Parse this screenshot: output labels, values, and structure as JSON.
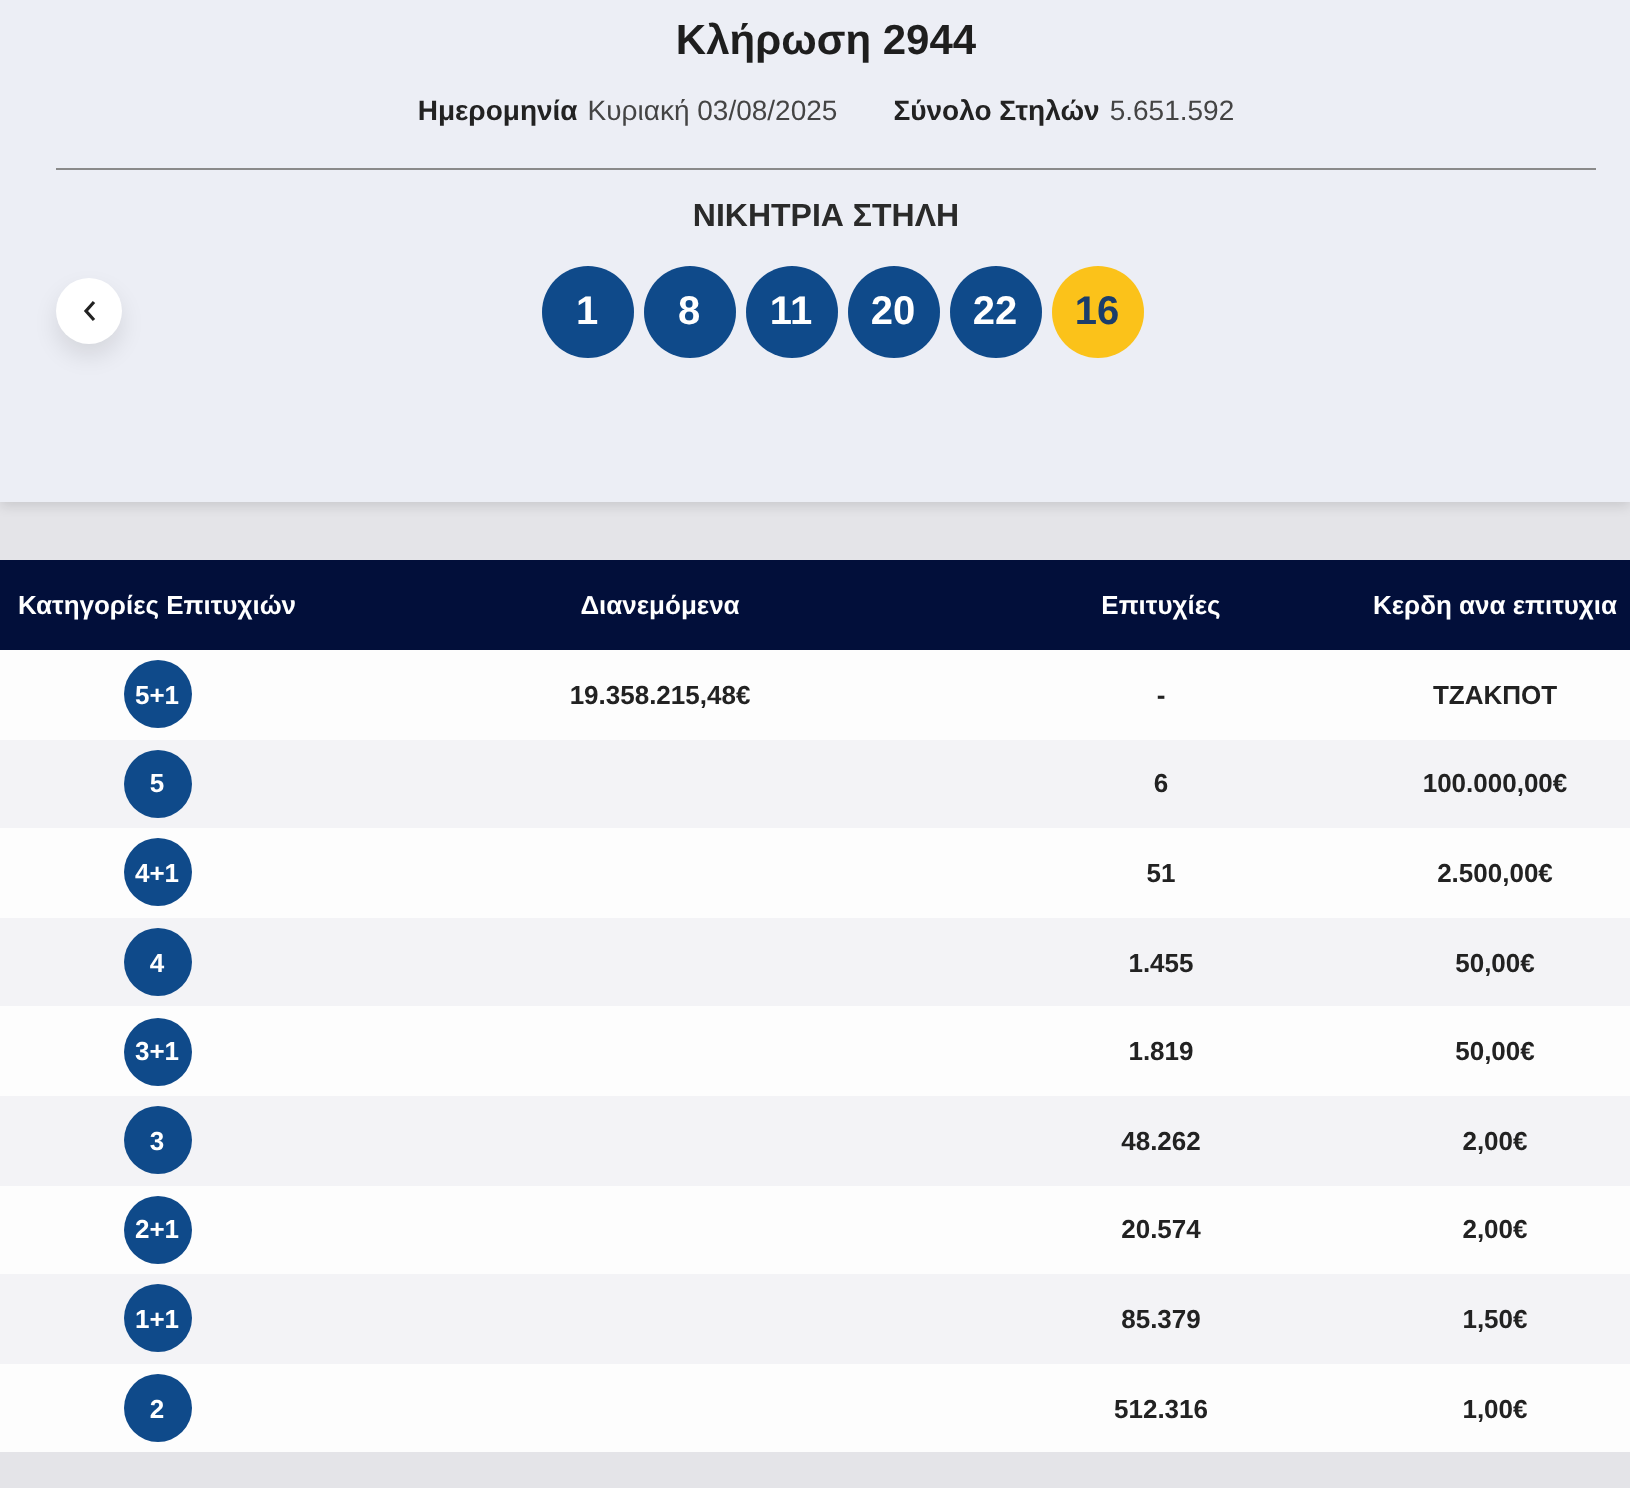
{
  "draw": {
    "title": "Κλήρωση 2944",
    "meta": [
      {
        "label": "Ημερομηνία",
        "value": "Κυριακή 03/08/2025"
      },
      {
        "label": "Σύνολο Στηλών",
        "value": "5.651.592"
      }
    ],
    "winning_label": "ΝΙΚΗΤΡΙΑ ΣΤΗΛΗ",
    "numbers": [
      {
        "value": "1",
        "kind": "main"
      },
      {
        "value": "8",
        "kind": "main"
      },
      {
        "value": "11",
        "kind": "main"
      },
      {
        "value": "20",
        "kind": "main"
      },
      {
        "value": "22",
        "kind": "main"
      },
      {
        "value": "16",
        "kind": "bonus"
      }
    ]
  },
  "table": {
    "columns": [
      "Κατηγορίες Επιτυχιών",
      "Διανεμόμενα",
      "Επιτυχίες",
      "Κερδη ανα επιτυχια"
    ],
    "rows": [
      {
        "category": "5+1",
        "distributed": "19.358.215,48€",
        "winners": "-",
        "prize": "ΤΖΑΚΠΟΤ"
      },
      {
        "category": "5",
        "winners": "6",
        "prize": "100.000,00€"
      },
      {
        "category": "4+1",
        "winners": "51",
        "prize": "2.500,00€"
      },
      {
        "category": "4",
        "winners": "1.455",
        "prize": "50,00€"
      },
      {
        "category": "3+1",
        "winners": "1.819",
        "prize": "50,00€"
      },
      {
        "category": "3",
        "winners": "48.262",
        "prize": "2,00€"
      },
      {
        "category": "2+1",
        "winners": "20.574",
        "prize": "2,00€"
      },
      {
        "category": "1+1",
        "winners": "85.379",
        "prize": "1,50€"
      },
      {
        "category": "2",
        "winners": "512.316",
        "prize": "1,00€"
      }
    ]
  }
}
